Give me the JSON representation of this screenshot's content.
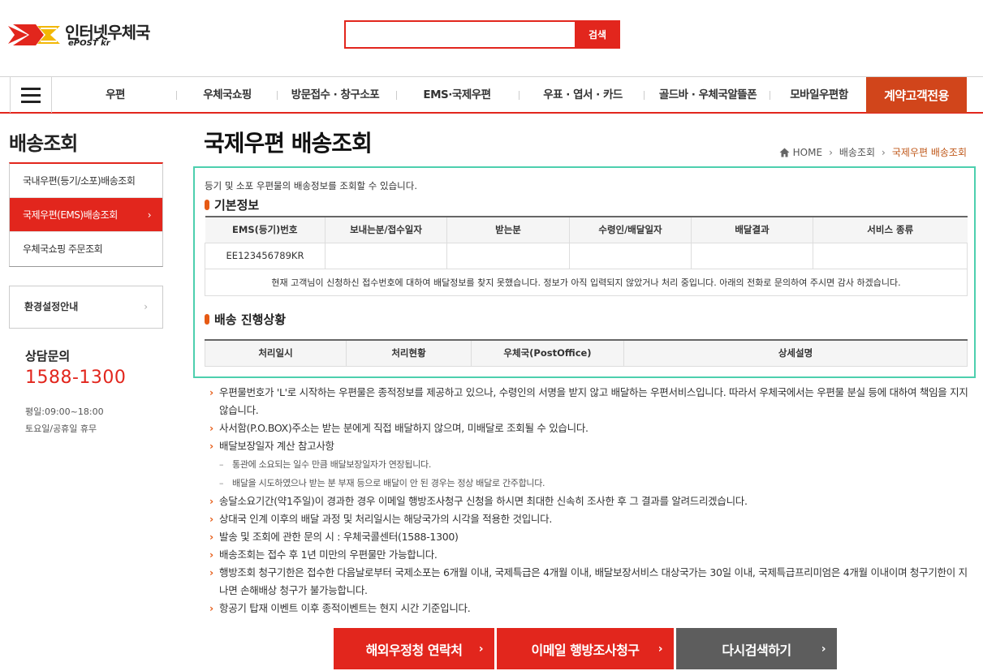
{
  "header": {
    "logo_main": "인터넷우체국",
    "logo_sub": "ePOST kr",
    "search_placeholder": "",
    "search_button": "검색"
  },
  "nav": {
    "items": [
      "우편",
      "우체국쇼핑",
      "방문접수 · 창구소포",
      "EMS·국제우편",
      "우표 · 엽서 · 카드",
      "골드바 · 우체국알뜰폰",
      "모바일우편함"
    ],
    "special": "계약고객전용"
  },
  "sidebar": {
    "title": "배송조회",
    "items": [
      "국내우편(등기/소포)배송조회",
      "국제우편(EMS)배송조회",
      "우체국쇼핑 주문조회"
    ],
    "active_index": 1,
    "env_label": "환경설정안내",
    "consult_title": "상담문의",
    "consult_phone": "1588-1300",
    "consult_hours_1": "평일:09:00~18:00",
    "consult_hours_2": "토요일/공휴일 휴무"
  },
  "main": {
    "page_title": "국제우편 배송조회",
    "breadcrumb": [
      "HOME",
      "배송조회",
      "국제우편 배송조회"
    ],
    "intro": "등기 및 소포 우편물의 배송정보를 조회할 수 있습니다.",
    "basic_info": {
      "title": "기본정보",
      "columns": [
        "EMS(등기)번호",
        "보내는분/접수일자",
        "받는분",
        "수령인/배달일자",
        "배달결과",
        "서비스 종류"
      ],
      "row": [
        "EE123456789KR",
        "",
        "",
        "",
        "",
        ""
      ],
      "notice": "현재 고객님이 신청하신 접수번호에 대하여 배달정보를 찾지 못했습니다. 정보가 아직 입력되지 않았거나 처리 중입니다. 아래의 전화로 문의하여 주시면 감사 하겠습니다."
    },
    "progress": {
      "title": "배송 진행상황",
      "columns": [
        "처리일시",
        "처리현황",
        "우체국(PostOffice)",
        "상세설명"
      ]
    },
    "notes": {
      "n1": "우편물번호가 'L'로 시작하는 우편물은 종적정보를 제공하고 있으나, 수령인의 서명을 받지 않고 배달하는 우편서비스입니다. 따라서 우체국에서는 우편물 분실 등에 대하여 책임을 지지 않습니다.",
      "n2": "사서함(P.O.BOX)주소는 받는 분에게 직접 배달하지 않으며, 미배달로 조회될 수 있습니다.",
      "n3": "배달보장일자 계산 참고사항",
      "s1": "통관에 소요되는 일수 만큼 배달보장일자가 연장됩니다.",
      "s2": "배달을 시도하였으나 받는 분 부재 등으로 배달이 안 된 경우는 정상 배달로 간주합니다.",
      "n4": "송달소요기간(약1주일)이 경과한 경우 이메일 행방조사청구 신청을 하시면 최대한 신속히 조사한 후 그 결과를 알려드리겠습니다.",
      "n5": "상대국 인계 이후의 배달 과정 및 처리일시는 해당국가의 시각을 적용한 것입니다.",
      "n6": "발송 및 조회에 관한 문의 시 : 우체국콜센터(1588-1300)",
      "n7": "배송조회는 접수 후 1년 미만의 우편물만 가능합니다.",
      "n8": "행방조회 청구기한은 접수한 다음날로부터 국제소포는 6개월 이내, 국제특급은 4개월 이내, 배달보장서비스 대상국가는 30일 이내, 국제특급프리미엄은 4개월 이내이며 청구기한이 지나면 손해배상 청구가 불가능합니다.",
      "n9": "항공기 탑재 이벤트 이후 종적이벤트는 현지 시간 기준입니다."
    },
    "buttons": {
      "contact": "해외우정청 연락처",
      "email": "이메일 행방조사청구",
      "research": "다시검색하기"
    }
  },
  "colors": {
    "brand_red": "#e2261d",
    "special_orange": "#d1451b",
    "highlight_teal": "#4dcfae",
    "bullet_orange": "#e65a14",
    "button_gray": "#5d5d5d"
  }
}
